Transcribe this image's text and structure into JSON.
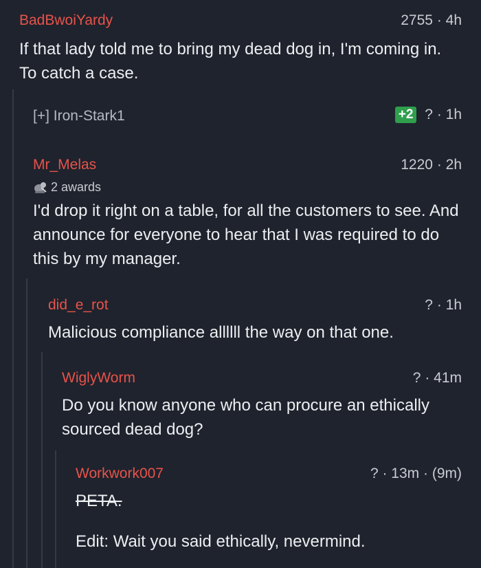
{
  "comments": [
    {
      "author": "BadBwoiYardy",
      "score": "2755",
      "time": "4h",
      "body": "If that lady told me to bring my dead dog in, I'm coming in. To catch a case."
    },
    {
      "collapsed_label": "[+] Iron-Stark1",
      "badge": "+2",
      "score": "?",
      "time": "1h"
    },
    {
      "author": "Mr_Melas",
      "score": "1220",
      "time": "2h",
      "awards": "2 awards",
      "body": "I'd drop it right on a table, for all the customers to see. And announce for everyone to hear that I was required to do this by my manager."
    },
    {
      "author": "did_e_rot",
      "score": "?",
      "time": "1h",
      "body": "Malicious compliance allllll the way on that one."
    },
    {
      "author": "WiglyWorm",
      "score": "?",
      "time": "41m",
      "body": "Do you know anyone who can procure an ethically sourced dead dog?"
    },
    {
      "author": "Workwork007",
      "score": "?",
      "time": "13m",
      "edited": "(9m)",
      "struck": "PETA.",
      "body": "Edit: Wait you said ethically, nevermind."
    }
  ],
  "separator": "·",
  "icons": {
    "award": "award-icon"
  }
}
